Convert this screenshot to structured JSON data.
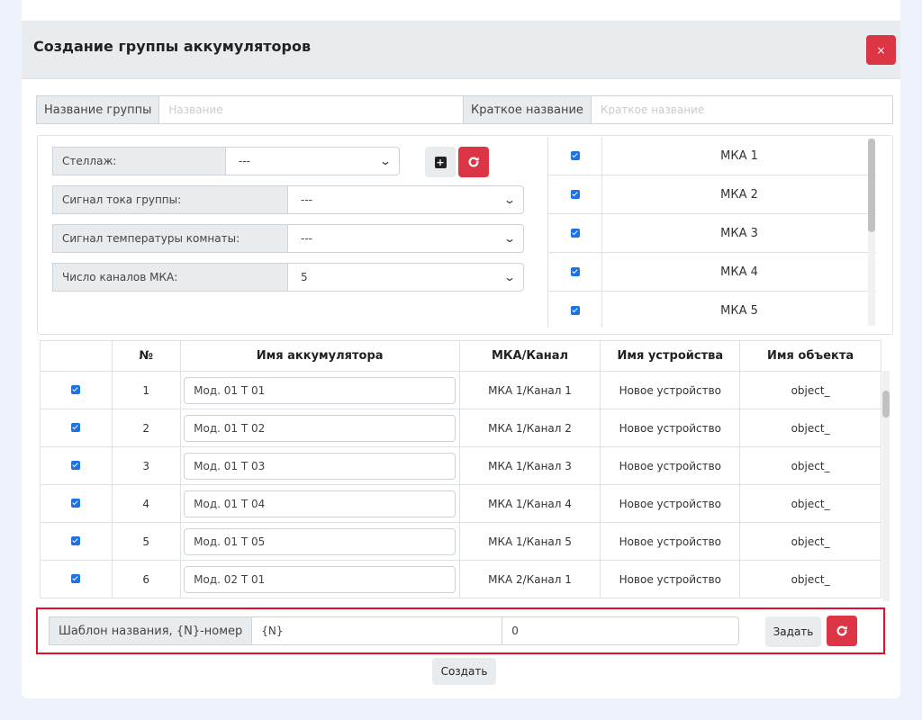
{
  "modal": {
    "title": "Создание группы аккумуляторов",
    "close_label": "×"
  },
  "group_name": {
    "label": "Название группы",
    "placeholder": "Название",
    "value": ""
  },
  "short_name": {
    "label": "Краткое название",
    "placeholder": "Краткое название",
    "value": ""
  },
  "selects": {
    "rack": {
      "label": "Стеллаж:",
      "value": "---"
    },
    "group_current_signal": {
      "label": "Сигнал тока группы:",
      "value": "---"
    },
    "room_temp_signal": {
      "label": "Сигнал температуры комнаты:",
      "value": "---"
    },
    "mka_channels": {
      "label": "Число каналов МКА:",
      "value": "5"
    }
  },
  "mka_list": [
    {
      "name": "МКА 1",
      "checked": true
    },
    {
      "name": "МКА 2",
      "checked": true
    },
    {
      "name": "МКА 3",
      "checked": true
    },
    {
      "name": "МКА 4",
      "checked": true
    },
    {
      "name": "МКА 5",
      "checked": true
    }
  ],
  "table": {
    "headers": [
      "",
      "№",
      "Имя аккумулятора",
      "МКА/Канал",
      "Имя устройства",
      "Имя объекта"
    ],
    "rows": [
      {
        "num": "1",
        "name": "Мод. 01 Т 01",
        "channel": "МКА 1/Канал 1",
        "device": "Новое устройство",
        "object": "object_",
        "checked": true
      },
      {
        "num": "2",
        "name": "Мод. 01 Т 02",
        "channel": "МКА 1/Канал 2",
        "device": "Новое устройство",
        "object": "object_",
        "checked": true
      },
      {
        "num": "3",
        "name": "Мод. 01 Т 03",
        "channel": "МКА 1/Канал 3",
        "device": "Новое устройство",
        "object": "object_",
        "checked": true
      },
      {
        "num": "4",
        "name": "Мод. 01 Т 04",
        "channel": "МКА 1/Канал 4",
        "device": "Новое устройство",
        "object": "object_",
        "checked": true
      },
      {
        "num": "5",
        "name": "Мод. 01 Т 05",
        "channel": "МКА 1/Канал 5",
        "device": "Новое устройство",
        "object": "object_",
        "checked": true
      },
      {
        "num": "6",
        "name": "Мод. 02 Т 01",
        "channel": "МКА 2/Канал 1",
        "device": "Новое устройство",
        "object": "object_",
        "checked": true
      }
    ]
  },
  "template": {
    "label": "Шаблон названия, {N}-номер",
    "pattern_value": "{N}",
    "start_value": "0",
    "apply_label": "Задать"
  },
  "create_label": "Создать",
  "colors": {
    "accent_red": "#dc3545",
    "highlight_red": "#e0102d",
    "checkbox_blue": "#1a73e8"
  },
  "icons": {
    "add": "plus-square-icon",
    "refresh": "redo-icon",
    "close": "close-icon"
  }
}
